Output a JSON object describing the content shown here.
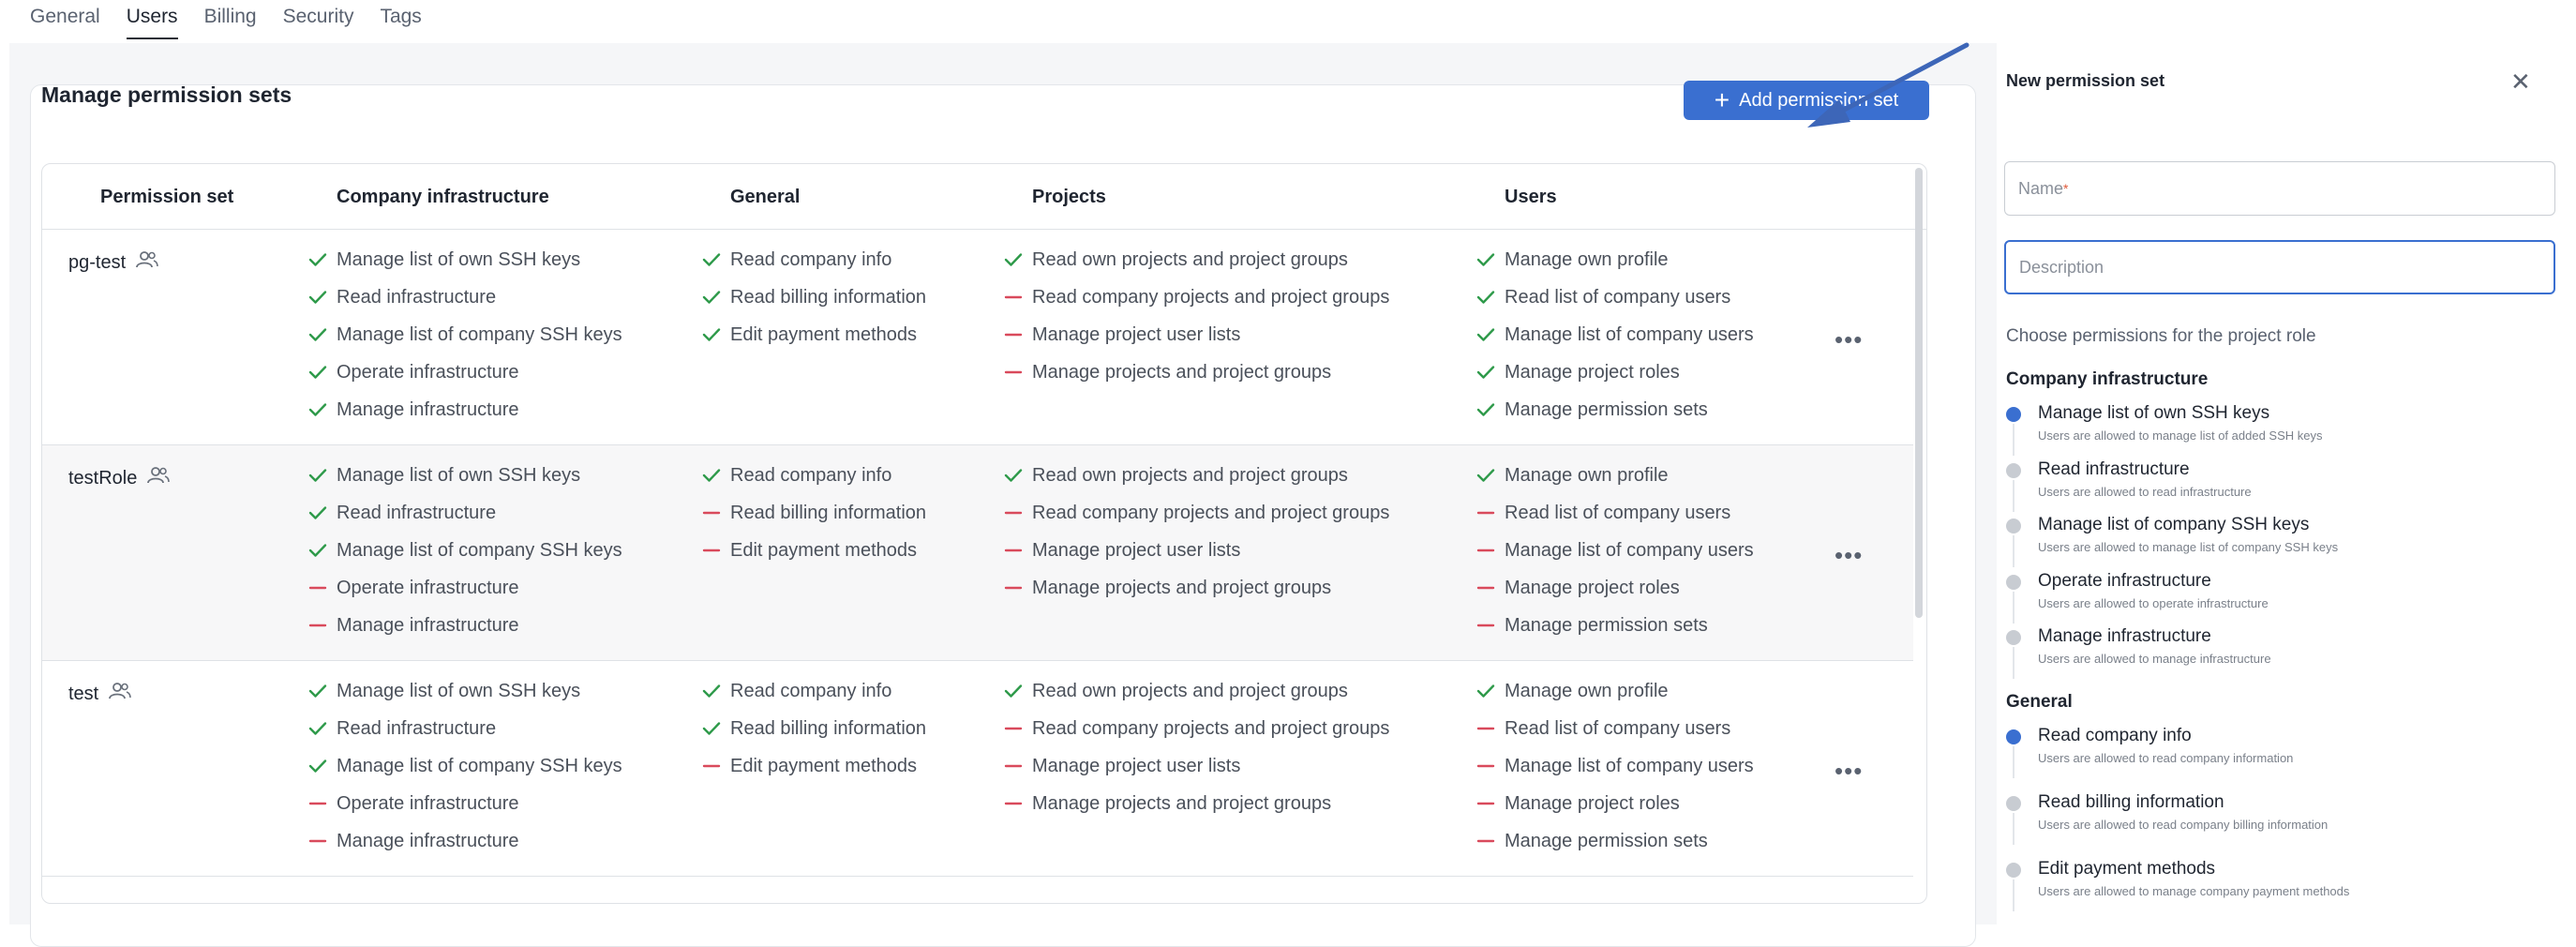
{
  "tabs": [
    "General",
    "Users",
    "Billing",
    "Security",
    "Tags"
  ],
  "card": {
    "title": "Manage permission sets",
    "add_button": "Add permission set"
  },
  "columns": [
    "Permission set",
    "Company infrastructure",
    "General",
    "Projects",
    "Users"
  ],
  "rows": [
    {
      "name": "pg-test",
      "infra": [
        [
          "Manage list of own SSH keys",
          true
        ],
        [
          "Read infrastructure",
          true
        ],
        [
          "Manage list of company SSH keys",
          true
        ],
        [
          "Operate infrastructure",
          true
        ],
        [
          "Manage infrastructure",
          true
        ]
      ],
      "general": [
        [
          "Read company info",
          true
        ],
        [
          "Read billing information",
          true
        ],
        [
          "Edit payment methods",
          true
        ]
      ],
      "projects": [
        [
          "Read own projects and project groups",
          true
        ],
        [
          "Read company projects and project groups",
          false
        ],
        [
          "Manage project user lists",
          false
        ],
        [
          "Manage projects and project groups",
          false
        ]
      ],
      "users": [
        [
          "Manage own profile",
          true
        ],
        [
          "Read list of company users",
          true
        ],
        [
          "Manage list of company users",
          true
        ],
        [
          "Manage project roles",
          true
        ],
        [
          "Manage permission sets",
          true
        ]
      ]
    },
    {
      "name": "testRole",
      "infra": [
        [
          "Manage list of own SSH keys",
          true
        ],
        [
          "Read infrastructure",
          true
        ],
        [
          "Manage list of company SSH keys",
          true
        ],
        [
          "Operate infrastructure",
          false
        ],
        [
          "Manage infrastructure",
          false
        ]
      ],
      "general": [
        [
          "Read company info",
          true
        ],
        [
          "Read billing information",
          false
        ],
        [
          "Edit payment methods",
          false
        ]
      ],
      "projects": [
        [
          "Read own projects and project groups",
          true
        ],
        [
          "Read company projects and project groups",
          false
        ],
        [
          "Manage project user lists",
          false
        ],
        [
          "Manage projects and project groups",
          false
        ]
      ],
      "users": [
        [
          "Manage own profile",
          true
        ],
        [
          "Read list of company users",
          false
        ],
        [
          "Manage list of company users",
          false
        ],
        [
          "Manage project roles",
          false
        ],
        [
          "Manage permission sets",
          false
        ]
      ]
    },
    {
      "name": "test",
      "infra": [
        [
          "Manage list of own SSH keys",
          true
        ],
        [
          "Read infrastructure",
          true
        ],
        [
          "Manage list of company SSH keys",
          true
        ],
        [
          "Operate infrastructure",
          false
        ],
        [
          "Manage infrastructure",
          false
        ]
      ],
      "general": [
        [
          "Read company info",
          true
        ],
        [
          "Read billing information",
          true
        ],
        [
          "Edit payment methods",
          false
        ]
      ],
      "projects": [
        [
          "Read own projects and project groups",
          true
        ],
        [
          "Read company projects and project groups",
          false
        ],
        [
          "Manage project user lists",
          false
        ],
        [
          "Manage projects and project groups",
          false
        ]
      ],
      "users": [
        [
          "Manage own profile",
          true
        ],
        [
          "Read list of company users",
          false
        ],
        [
          "Manage list of company users",
          false
        ],
        [
          "Manage project roles",
          false
        ],
        [
          "Manage permission sets",
          false
        ]
      ]
    }
  ],
  "panel": {
    "title": "New permission set",
    "name_placeholder": "Name",
    "description_placeholder": "Description",
    "choose_label": "Choose permissions for the project role",
    "sections": [
      {
        "title": "Company infrastructure",
        "options": [
          {
            "label": "Manage list of own SSH keys",
            "desc": "Users are allowed to manage list of added SSH keys",
            "selected": true
          },
          {
            "label": "Read infrastructure",
            "desc": "Users are allowed to read infrastructure",
            "selected": false
          },
          {
            "label": "Manage list of company SSH keys",
            "desc": "Users are allowed to manage list of company SSH keys",
            "selected": false
          },
          {
            "label": "Operate infrastructure",
            "desc": "Users are allowed to operate infrastructure",
            "selected": false
          },
          {
            "label": "Manage infrastructure",
            "desc": "Users are allowed to manage infrastructure",
            "selected": false
          }
        ]
      },
      {
        "title": "General",
        "options": [
          {
            "label": "Read company info",
            "desc": "Users are allowed to read company information",
            "selected": true
          },
          {
            "label": "Read billing information",
            "desc": "Users are allowed to read company billing information",
            "selected": false
          },
          {
            "label": "Edit payment methods",
            "desc": "Users are allowed to manage company payment methods",
            "selected": false
          }
        ]
      }
    ]
  },
  "colors": {
    "accent": "#3a6fd0",
    "allowed": "#2e9a4a",
    "denied": "#d94a5c",
    "required": "#e05a3a"
  },
  "icons": {
    "user_group": "users-icon",
    "check": "check-icon",
    "dash": "dash-icon",
    "more": "more-icon",
    "close": "close-icon",
    "plus": "plus-icon"
  }
}
